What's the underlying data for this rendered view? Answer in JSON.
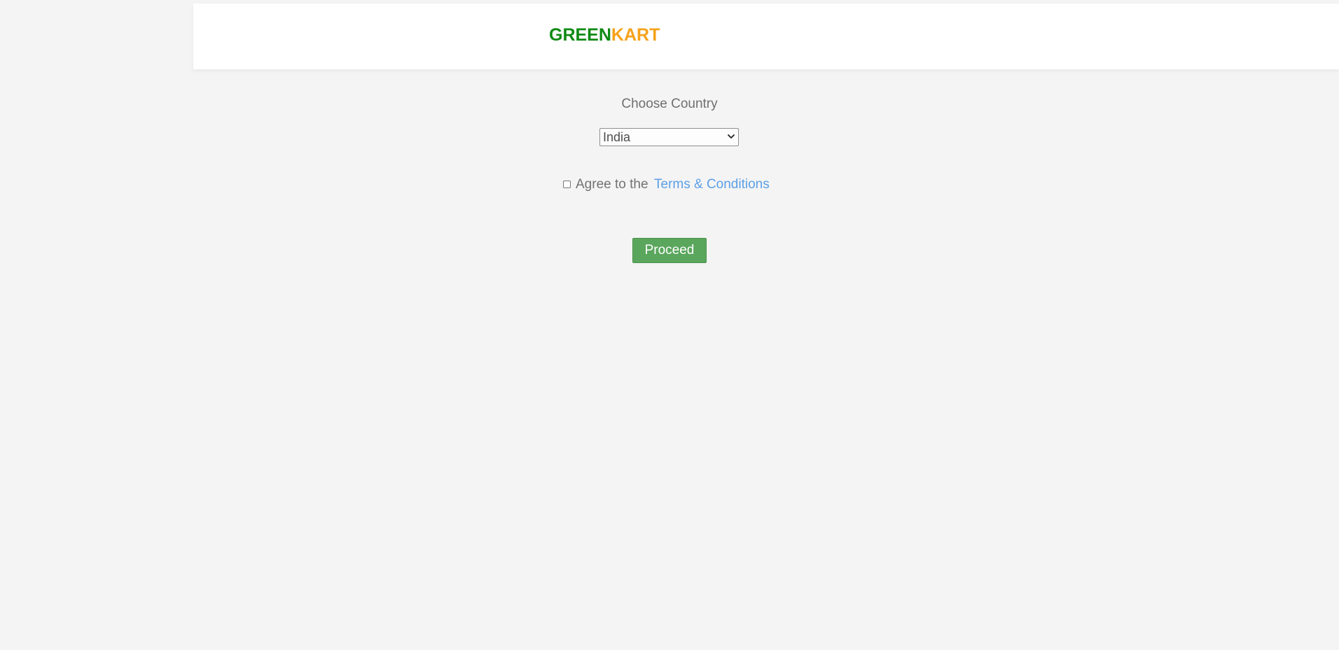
{
  "header": {
    "logo_green": "GREEN",
    "logo_orange": "KART"
  },
  "country": {
    "label": "Choose Country",
    "selected": "India"
  },
  "agreement": {
    "text": "Agree to the",
    "link": "Terms & Conditions",
    "checked": false
  },
  "actions": {
    "proceed_label": "Proceed"
  },
  "colors": {
    "brand_green": "#0f8a14",
    "brand_orange": "#f6a21b",
    "link_blue": "#5b9fe6",
    "button_green": "#5aa65d",
    "page_background": "#f4f4f4"
  },
  "icons": {
    "select_caret": "chevron-down-icon"
  }
}
